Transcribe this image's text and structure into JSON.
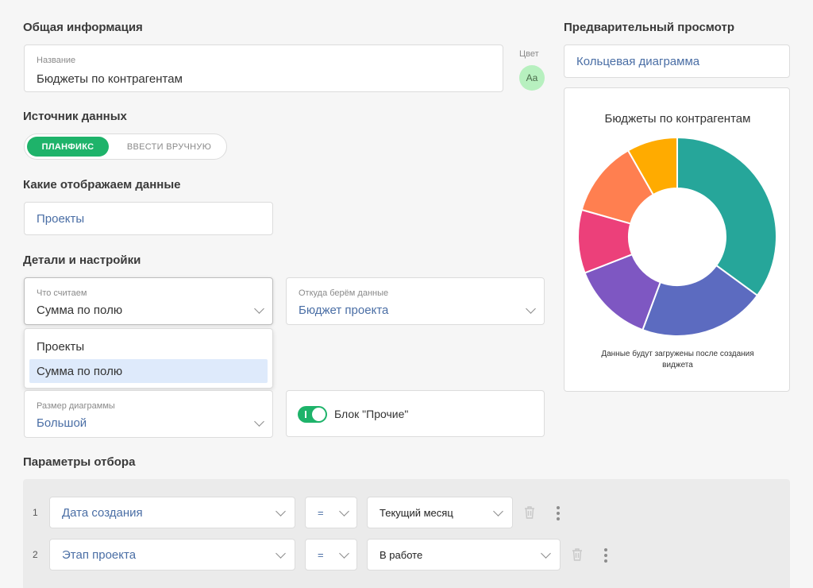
{
  "general": {
    "title": "Общая информация",
    "name_label": "Название",
    "name_value": "Бюджеты по контрагентам",
    "color_label": "Цвет",
    "color_sample": "Aa"
  },
  "source": {
    "title": "Источник данных",
    "options": [
      "ПЛАНФИКС",
      "ВВЕСТИ ВРУЧНУЮ"
    ],
    "selected": "ПЛАНФИКС"
  },
  "display": {
    "title": "Какие отображаем данные",
    "value": "Проекты"
  },
  "details": {
    "title": "Детали и настройки",
    "what_label": "Что считаем",
    "what_value": "Сумма по полю",
    "what_options": [
      "Проекты",
      "Сумма по полю"
    ],
    "from_label": "Откуда берём данные",
    "from_value": "Бюджет проекта",
    "size_label": "Размер диаграммы",
    "size_value": "Большой",
    "other_block_label": "Блок \"Прочие\"",
    "other_block_on": true
  },
  "filters": {
    "title": "Параметры отбора",
    "rows": [
      {
        "num": "1",
        "field": "Дата создания",
        "op": "=",
        "value": "Текущий месяц"
      },
      {
        "num": "2",
        "field": "Этап проекта",
        "op": "=",
        "value": "В работе"
      }
    ]
  },
  "preview": {
    "title": "Предварительный просмотр",
    "chart_type": "Кольцевая диаграмма",
    "chart_title": "Бюджеты по контрагентам",
    "note": "Данные будут загружены после создания виджета"
  },
  "colors": {
    "accent": "#1eb36a",
    "link": "#4a6ea5",
    "segments": [
      "#26a69a",
      "#5c6bc0",
      "#7e57c2",
      "#ec407a",
      "#ff7f50",
      "#ffab00"
    ]
  },
  "chart_data": {
    "type": "pie",
    "title": "Бюджеты по контрагентам",
    "values": [
      34,
      20,
      13,
      10,
      12,
      8
    ],
    "colors": [
      "#26a69a",
      "#5c6bc0",
      "#7e57c2",
      "#ec407a",
      "#ff7f50",
      "#ffab00"
    ]
  }
}
